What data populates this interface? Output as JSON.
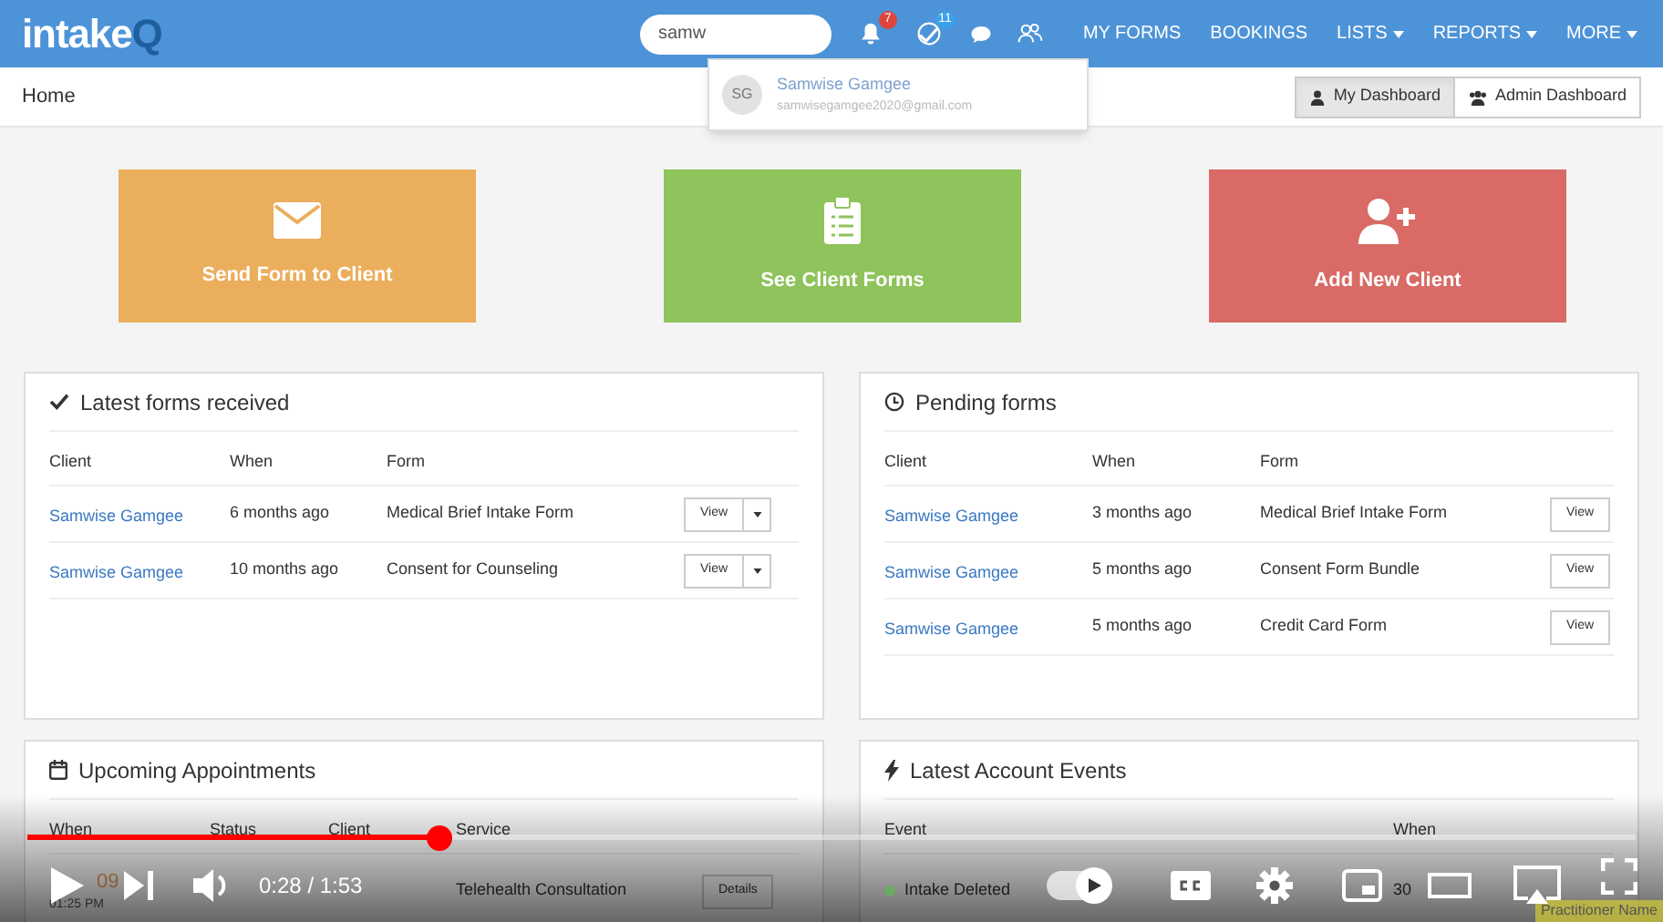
{
  "header": {
    "logo": "intake",
    "logo_accent": "Q",
    "search": {
      "value": "samw"
    },
    "notifications": {
      "count": "7"
    },
    "tasks": {
      "count": "11"
    },
    "nav": [
      {
        "label": "MY FORMS",
        "dropdown": false
      },
      {
        "label": "BOOKINGS",
        "dropdown": false
      },
      {
        "label": "LISTS",
        "dropdown": true
      },
      {
        "label": "REPORTS",
        "dropdown": true
      },
      {
        "label": "MORE",
        "dropdown": true
      }
    ]
  },
  "search_results": [
    {
      "initials": "SG",
      "name": "Samwise Gamgee",
      "email": "samwisegamgee2020@gmail.com"
    }
  ],
  "breadcrumb": "Home",
  "dashboard_tabs": [
    {
      "label": "My Dashboard",
      "selected": true,
      "kind": "user"
    },
    {
      "label": "Admin Dashboard",
      "selected": false,
      "kind": "users"
    }
  ],
  "tiles": [
    {
      "kind": "envelope",
      "label": "Send Form to Client",
      "color": "#ebae5c"
    },
    {
      "kind": "clipboard",
      "label": "See Client Forms",
      "color": "#8fc35b"
    },
    {
      "kind": "user-plus",
      "label": "Add New Client",
      "color": "#d96a65"
    }
  ],
  "latest_forms": {
    "title": "Latest forms received",
    "columns": [
      "Client",
      "When",
      "Form"
    ],
    "rows": [
      {
        "client": "Samwise Gamgee",
        "when": "6 months ago",
        "form": "Medical Brief Intake Form",
        "button": "View",
        "dropdown": true
      },
      {
        "client": "Samwise Gamgee",
        "when": "10 months ago",
        "form": "Consent for Counseling",
        "button": "View",
        "dropdown": true
      }
    ]
  },
  "pending_forms": {
    "title": "Pending forms",
    "columns": [
      "Client",
      "When",
      "Form"
    ],
    "rows": [
      {
        "client": "Samwise Gamgee",
        "when": "3 months ago",
        "form": "Medical Brief Intake Form",
        "button": "View",
        "dropdown": false
      },
      {
        "client": "Samwise Gamgee",
        "when": "5 months ago",
        "form": "Consent Form Bundle",
        "button": "View",
        "dropdown": false
      },
      {
        "client": "Samwise Gamgee",
        "when": "5 months ago",
        "form": "Credit Card Form",
        "button": "View",
        "dropdown": false
      }
    ]
  },
  "upcoming_appointments": {
    "title": "Upcoming Appointments",
    "columns": [
      "When",
      "Status",
      "Client",
      "Service"
    ],
    "rows": [
      {
        "date": "09",
        "time": "01:25 PM",
        "service": "Telehealth Consultation",
        "button": "Details"
      }
    ]
  },
  "account_events": {
    "title": "Latest Account Events",
    "columns": [
      "Event",
      "When"
    ],
    "rows": [
      {
        "event": "Intake Deleted",
        "color": "#6aaa64",
        "when": "30"
      }
    ]
  },
  "practitioner_tag": "Practitioner Name",
  "video_player": {
    "progress": {
      "level": 0.256
    },
    "time": "0:28 / 1:53",
    "autoplay": {
      "on": true
    }
  }
}
